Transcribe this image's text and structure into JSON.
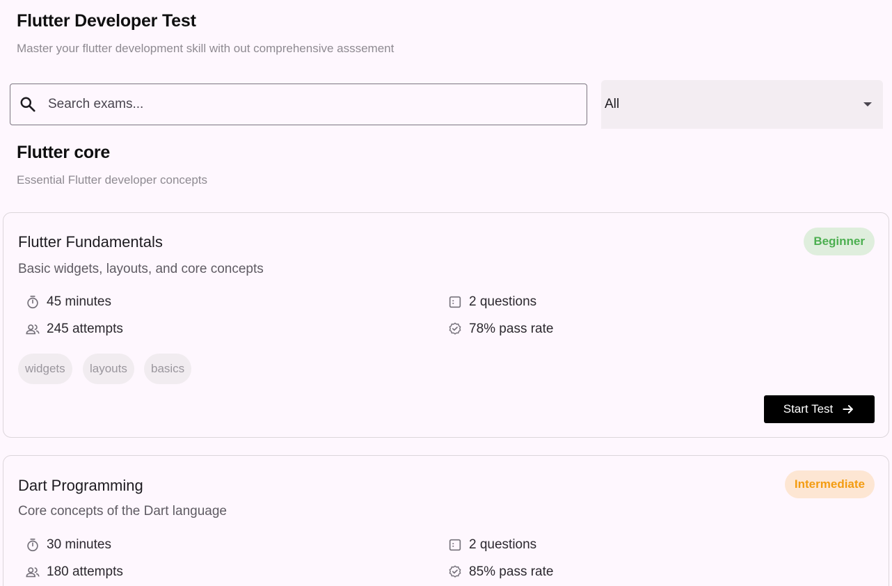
{
  "header": {
    "title": "Flutter Developer Test",
    "subtitle": "Master your flutter development skill with out comprehensive asssement"
  },
  "search": {
    "placeholder": "Search exams...",
    "value": "",
    "icon": "search-icon"
  },
  "filter": {
    "selected": "All"
  },
  "section": {
    "title": "Flutter core",
    "subtitle": "Essential Flutter developer concepts"
  },
  "exams": [
    {
      "title": "Flutter Fundamentals",
      "description": "Basic widgets, layouts, and core concepts",
      "level": "Beginner",
      "level_color": "#4caf50",
      "level_bg": "#dfeedd",
      "duration": "45 minutes",
      "questions": "2 questions",
      "attempts": "245 attempts",
      "pass_rate": "78% pass rate",
      "tags": [
        "widgets",
        "layouts",
        "basics"
      ],
      "button_label": "Start Test"
    },
    {
      "title": "Dart Programming",
      "description": "Core concepts of the Dart language",
      "level": "Intermediate",
      "level_color": "#f39c12",
      "level_bg": "#fde6d3",
      "duration": "30 minutes",
      "questions": "2 questions",
      "attempts": "180 attempts",
      "pass_rate": "85% pass rate"
    }
  ],
  "colors": {
    "background": "#fef7fe",
    "button": "#000000",
    "beginner": "#4caf50",
    "intermediate": "#f39c12"
  }
}
